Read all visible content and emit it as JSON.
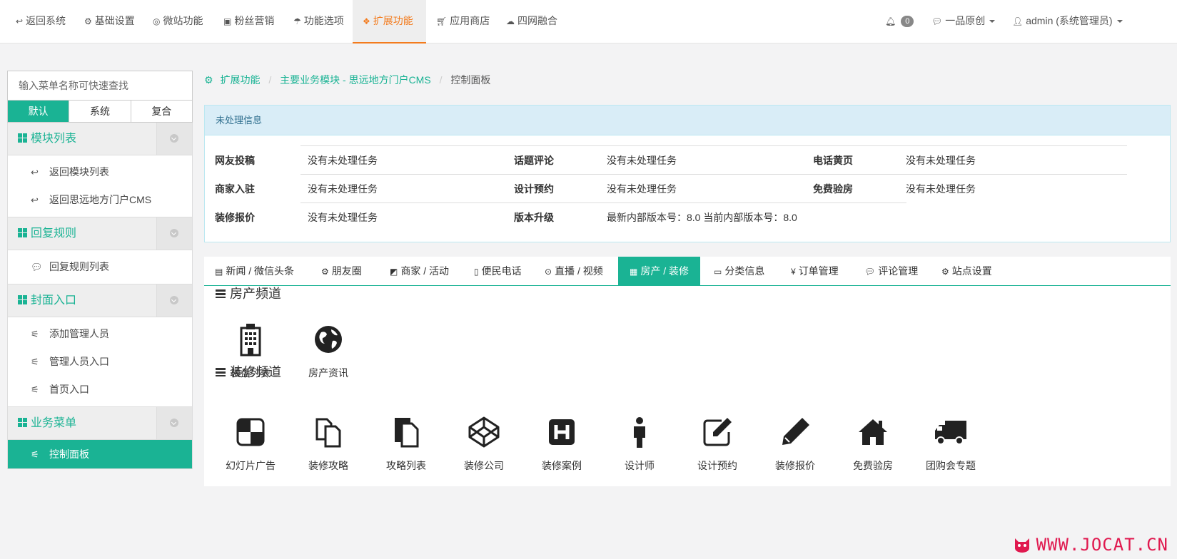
{
  "topnav": {
    "items": [
      {
        "label": "返回系统",
        "icon": "reply-icon"
      },
      {
        "label": "基础设置",
        "icon": "gear-icon"
      },
      {
        "label": "微站功能",
        "icon": "lifebuoy-icon"
      },
      {
        "label": "粉丝营销",
        "icon": "gift-icon"
      },
      {
        "label": "功能选项",
        "icon": "umbrella-icon"
      },
      {
        "label": "扩展功能",
        "icon": "cubes-icon"
      },
      {
        "label": "应用商店",
        "icon": "cart-icon"
      },
      {
        "label": "四网融合",
        "icon": "cloud-icon"
      }
    ],
    "bell_count": "0",
    "wechat_account": "一品原创",
    "user": "admin (系统管理员)"
  },
  "sidebar": {
    "search_placeholder": "输入菜单名称可快速查找",
    "tabs": [
      "默认",
      "系统",
      "复合"
    ],
    "groups": [
      {
        "title": "模块列表",
        "items": [
          "返回模块列表",
          "返回思远地方门户CMS"
        ]
      },
      {
        "title": "回复规则",
        "items": [
          "回复规则列表"
        ]
      },
      {
        "title": "封面入口",
        "items": [
          "添加管理人员",
          "管理人员入口",
          "首页入口"
        ]
      },
      {
        "title": "业务菜单",
        "items": [
          "控制面板"
        ]
      }
    ]
  },
  "breadcrumb": {
    "root": "扩展功能",
    "module": "主要业务模块 - 思远地方门户CMS",
    "current": "控制面板"
  },
  "pending": {
    "title": "未处理信息",
    "columns": [
      [
        {
          "key": "网友投稿",
          "value": "没有未处理任务"
        },
        {
          "key": "商家入驻",
          "value": "没有未处理任务"
        },
        {
          "key": "装修报价",
          "value": "没有未处理任务"
        }
      ],
      [
        {
          "key": "话题评论",
          "value": "没有未处理任务"
        },
        {
          "key": "设计预约",
          "value": "没有未处理任务"
        },
        {
          "key": "版本升级",
          "value": "最新内部版本号：8.0   当前内部版本号：8.0"
        }
      ],
      [
        {
          "key": "电话黄页",
          "value": "没有未处理任务"
        },
        {
          "key": "免费验房",
          "value": "没有未处理任务"
        }
      ]
    ]
  },
  "tabs": [
    {
      "label": "新闻 / 微信头条",
      "icon": "newspaper-icon"
    },
    {
      "label": "朋友圈",
      "icon": "cogs-icon"
    },
    {
      "label": "商家 / 活动",
      "icon": "delicious-icon"
    },
    {
      "label": "便民电话",
      "icon": "mobile-icon"
    },
    {
      "label": "直播 / 视频",
      "icon": "play-icon"
    },
    {
      "label": "房产 / 装修",
      "icon": "building-icon"
    },
    {
      "label": "分类信息",
      "icon": "laptop-icon"
    },
    {
      "label": "订单管理",
      "icon": "yen-icon"
    },
    {
      "label": "评论管理",
      "icon": "wechat-icon"
    },
    {
      "label": "站点设置",
      "icon": "cogs-icon"
    }
  ],
  "house_section": {
    "title": "房产频道",
    "tiles": [
      {
        "label": "楼盘列表",
        "icon": "building-icon"
      },
      {
        "label": "房产资讯",
        "icon": "globe-icon"
      }
    ]
  },
  "decor_section": {
    "title": "装修频道",
    "tiles": [
      {
        "label": "幻灯片广告",
        "icon": "delicious-icon"
      },
      {
        "label": "装修攻略",
        "icon": "files-icon"
      },
      {
        "label": "攻略列表",
        "icon": "file-icon"
      },
      {
        "label": "装修公司",
        "icon": "codepen-icon"
      },
      {
        "label": "装修案例",
        "icon": "h-square-icon"
      },
      {
        "label": "设计师",
        "icon": "male-icon"
      },
      {
        "label": "设计预约",
        "icon": "edit-icon"
      },
      {
        "label": "装修报价",
        "icon": "pencil-icon"
      },
      {
        "label": "免费验房",
        "icon": "home-icon"
      },
      {
        "label": "团购会专题",
        "icon": "truck-icon"
      }
    ]
  },
  "watermark": "WWW.JOCAT.CN",
  "colors": {
    "accent": "#1ab394",
    "active_nav": "#f37b1d",
    "panel_head": "#d9edf7"
  }
}
